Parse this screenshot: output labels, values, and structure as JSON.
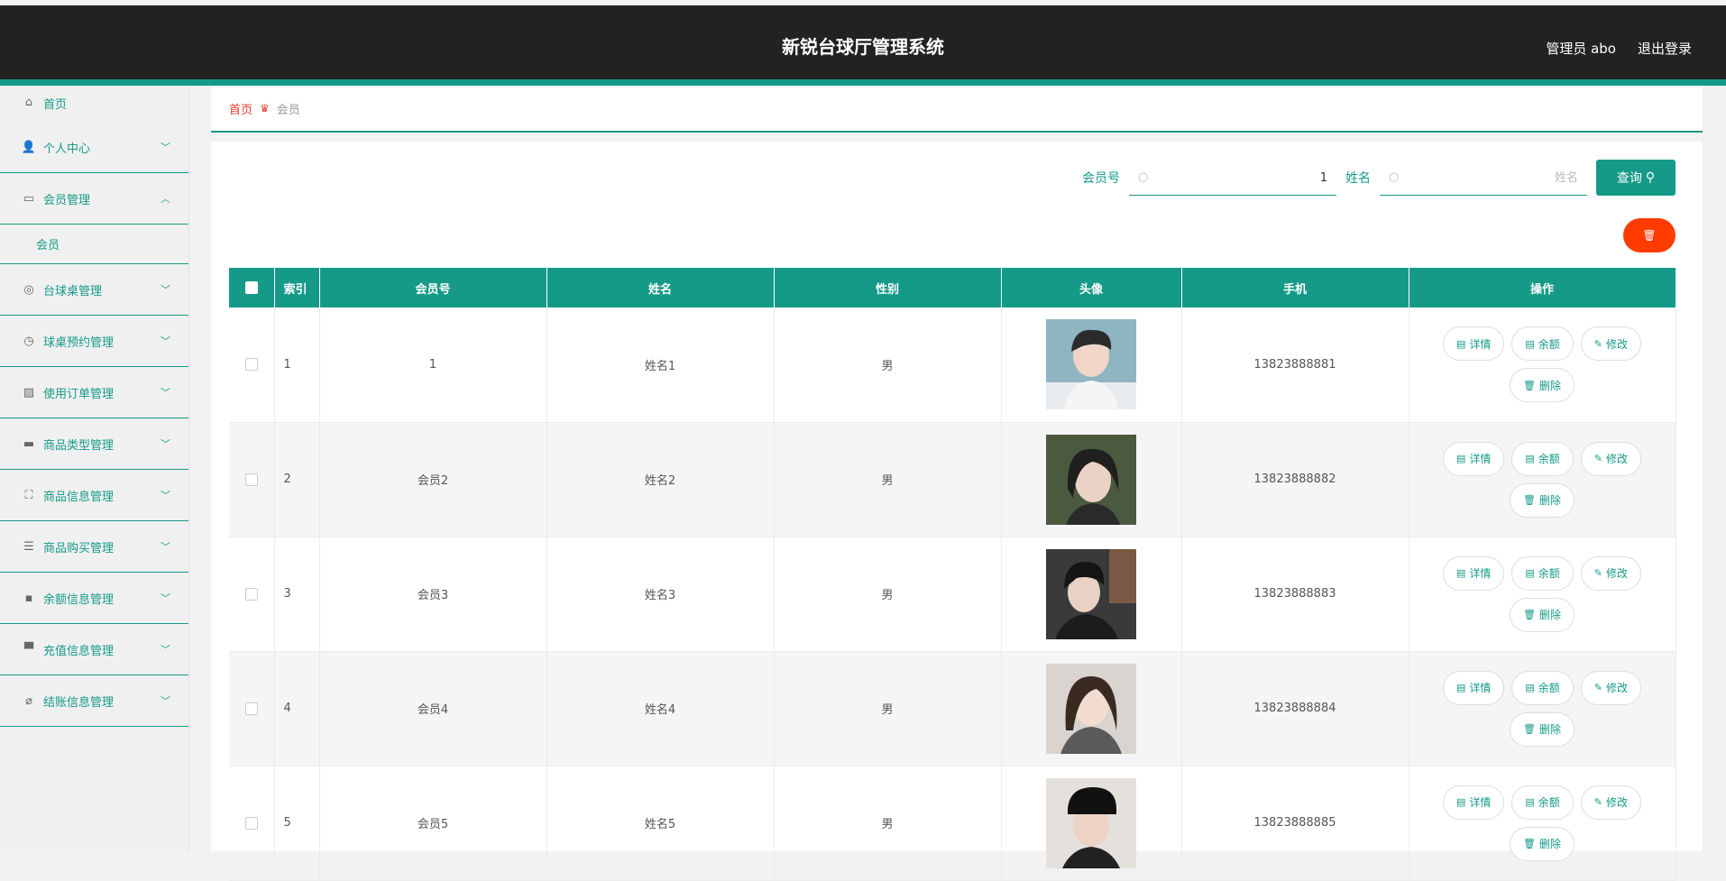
{
  "header": {
    "title": "新锐台球厅管理系统",
    "user": "管理员 abo",
    "logout": "退出登录"
  },
  "sidebar": {
    "home": "首页",
    "items": [
      {
        "label": "个人中心",
        "icon": "person-icon",
        "glyph": "👤",
        "chevron": "﹀"
      },
      {
        "label": "会员管理",
        "icon": "chat-icon",
        "glyph": "▭",
        "chevron": "︿"
      },
      {
        "label": "台球桌管理",
        "icon": "compass-icon",
        "glyph": "◎",
        "chevron": "﹀"
      },
      {
        "label": "球桌预约管理",
        "icon": "clock-icon",
        "glyph": "◷",
        "chevron": "﹀"
      },
      {
        "label": "使用订单管理",
        "icon": "chart-icon",
        "glyph": "▨",
        "chevron": "﹀"
      },
      {
        "label": "商品类型管理",
        "icon": "wallet-icon",
        "glyph": "▬",
        "chevron": "﹀"
      },
      {
        "label": "商品信息管理",
        "icon": "fullscreen-icon",
        "glyph": "⛶",
        "chevron": "﹀"
      },
      {
        "label": "商品购买管理",
        "icon": "list-icon",
        "glyph": "☰",
        "chevron": "﹀"
      },
      {
        "label": "余额信息管理",
        "icon": "message-icon",
        "glyph": "▪",
        "chevron": "﹀"
      },
      {
        "label": "充值信息管理",
        "icon": "stamp-icon",
        "glyph": "▀",
        "chevron": "﹀"
      },
      {
        "label": "结账信息管理",
        "icon": "bell-off-icon",
        "glyph": "⌀",
        "chevron": "﹀"
      }
    ],
    "sub_item": "会员"
  },
  "breadcrumb": {
    "home": "首页",
    "current": "会员"
  },
  "search": {
    "member_label": "会员号",
    "member_value": "1",
    "name_label": "姓名",
    "name_placeholder": "姓名",
    "query_label": "查询"
  },
  "table": {
    "headers": [
      "索引",
      "会员号",
      "姓名",
      "性别",
      "头像",
      "手机",
      "操作"
    ],
    "rows": [
      {
        "index": "1",
        "member_no": "1",
        "name": "姓名1",
        "gender": "男",
        "phone": "13823888881"
      },
      {
        "index": "2",
        "member_no": "会员2",
        "name": "姓名2",
        "gender": "男",
        "phone": "13823888882"
      },
      {
        "index": "3",
        "member_no": "会员3",
        "name": "姓名3",
        "gender": "男",
        "phone": "13823888883"
      },
      {
        "index": "4",
        "member_no": "会员4",
        "name": "姓名4",
        "gender": "男",
        "phone": "13823888884"
      },
      {
        "index": "5",
        "member_no": "会员5",
        "name": "姓名5",
        "gender": "男",
        "phone": "13823888885"
      }
    ],
    "actions": {
      "detail": "详情",
      "balance": "余额",
      "edit": "修改",
      "delete": "删除"
    }
  },
  "colors": {
    "accent": "#159a88",
    "topbar": "#222222",
    "danger": "#ff3b00",
    "breadcrumb_home": "#e23e2c"
  }
}
